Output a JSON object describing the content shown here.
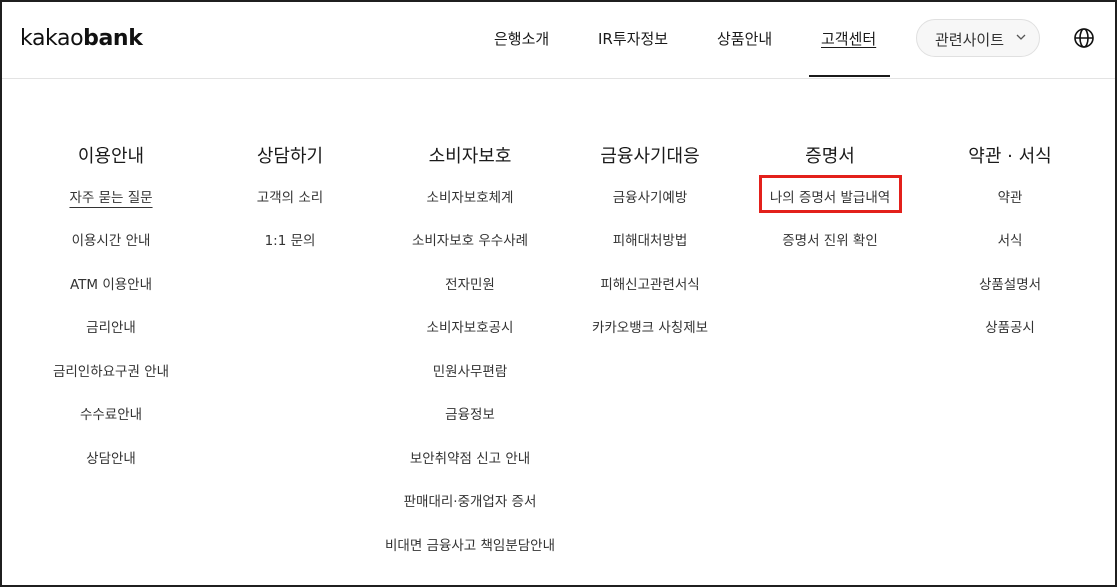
{
  "header": {
    "logo": {
      "part1": "kakao",
      "part2": "bank"
    },
    "nav": [
      {
        "label": "은행소개"
      },
      {
        "label": "IR투자정보"
      },
      {
        "label": "상품안내"
      },
      {
        "label": "고객센터",
        "active": true
      }
    ],
    "related_sites": {
      "label": "관련사이트",
      "icon": "chevron-down-icon"
    },
    "language_icon": "globe-icon"
  },
  "menu": {
    "columns": [
      {
        "title": "이용안내",
        "items": [
          "자주 묻는 질문",
          "이용시간 안내",
          "ATM 이용안내",
          "금리안내",
          "금리인하요구권 안내",
          "수수료안내",
          "상담안내"
        ]
      },
      {
        "title": "상담하기",
        "items": [
          "고객의 소리",
          "1:1 문의"
        ]
      },
      {
        "title": "소비자보호",
        "items": [
          "소비자보호체계",
          "소비자보호 우수사례",
          "전자민원",
          "소비자보호공시",
          "민원사무편람",
          "금융정보",
          "보안취약점 신고 안내",
          "판매대리·중개업자 증서",
          "비대면 금융사고 책임분담안내"
        ]
      },
      {
        "title": "금융사기대응",
        "items": [
          "금융사기예방",
          "피해대처방법",
          "피해신고관련서식",
          "카카오뱅크 사칭제보"
        ]
      },
      {
        "title": "증명서",
        "items": [
          "나의 증명서 발급내역",
          "증명서 진위 확인"
        ]
      },
      {
        "title": "약관 · 서식",
        "items": [
          "약관",
          "서식",
          "상품설명서",
          "상품공시"
        ]
      }
    ]
  },
  "colors": {
    "text": "#1a1a1a",
    "highlight_border": "#e3201b",
    "divider": "#e3e3e3"
  }
}
